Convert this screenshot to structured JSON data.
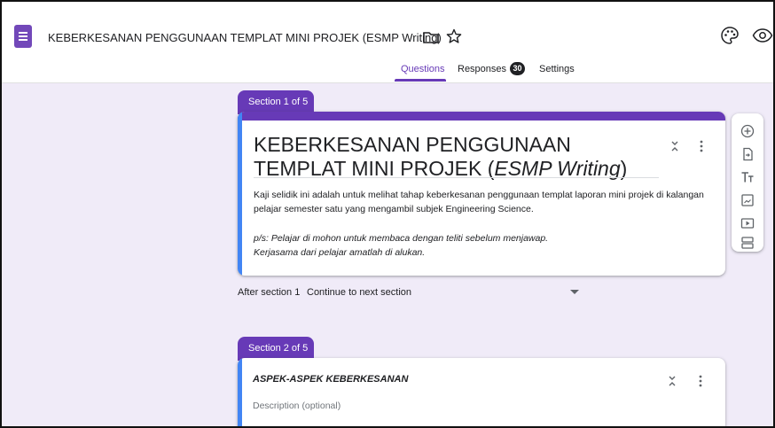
{
  "app": {
    "doc_title": "KEBERKESANAN PENGGUNAAN TEMPLAT MINI PROJEK (ESMP Writing)"
  },
  "tabs": [
    {
      "label": "Questions",
      "active": true
    },
    {
      "label": "Responses",
      "badge": "30"
    },
    {
      "label": "Settings"
    }
  ],
  "section1": {
    "tab_label": "Section 1 of 5",
    "title_main": "KEBERKESANAN PENGGUNAAN TEMPLAT MINI PROJEK (",
    "title_italic": "ESMP Writing",
    "title_end": ")",
    "description_line1": "Kaji selidik ini adalah untuk melihat tahap keberkesanan penggunaan templat laporan mini projek di kalangan pelajar semester satu yang mengambil subjek Engineering Science.",
    "description_note1": "p/s: Pelajar di mohon untuk membaca dengan teliti sebelum menjawap.",
    "description_note2": "Kerjasama dari pelajar amatlah di alukan."
  },
  "after_section": {
    "label": "After section 1",
    "value": "Continue to next section"
  },
  "section2": {
    "tab_label": "Section 2 of 5",
    "title": "ASPEK-ASPEK KEBERKESANAN",
    "description_placeholder": "Description (optional)"
  },
  "toolbar": {
    "items": [
      "add-question-icon",
      "import-questions-icon",
      "add-title-icon",
      "add-image-icon",
      "add-video-icon",
      "add-section-icon"
    ]
  },
  "colors": {
    "accent": "#673ab7",
    "background": "#f0ebf8",
    "focus": "#4285f4"
  }
}
